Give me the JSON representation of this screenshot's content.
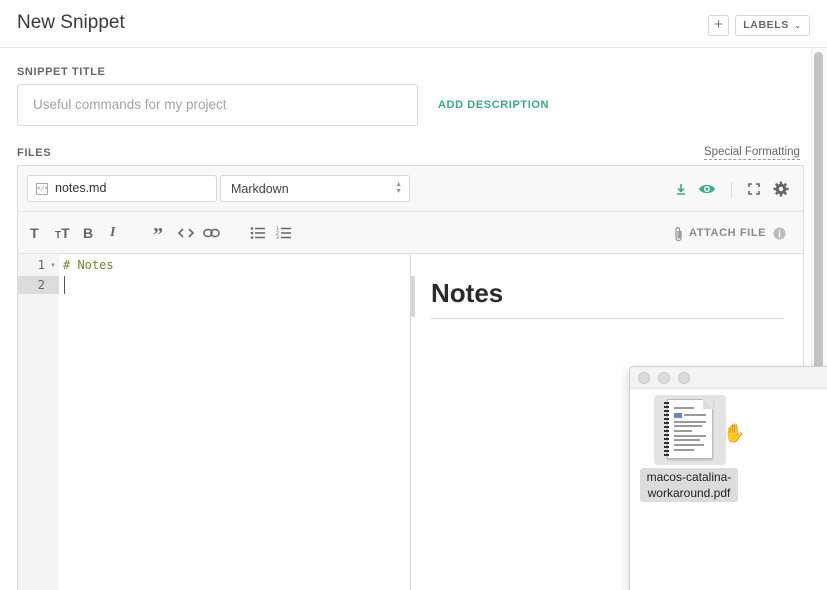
{
  "header": {
    "title": "New Snippet",
    "add_label": "+",
    "labels_button": "LABELS"
  },
  "snippet_title": {
    "label": "SNIPPET TITLE",
    "placeholder": "Useful commands for my project",
    "add_description": "ADD DESCRIPTION"
  },
  "files": {
    "label": "FILES",
    "special_formatting": "Special Formatting",
    "filename": "notes.md",
    "language": "Markdown",
    "icons": [
      "download-icon",
      "eye-icon",
      "fullscreen-icon",
      "gear-icon"
    ],
    "accent_color": "#3ba98b"
  },
  "format_toolbar": {
    "buttons": [
      {
        "name": "heading-icon",
        "glyph": "T"
      },
      {
        "name": "text-size-icon",
        "glyph": "TT"
      },
      {
        "name": "bold-icon",
        "glyph": "B"
      },
      {
        "name": "italic-icon",
        "glyph": "I"
      },
      {
        "name": "quote-icon",
        "glyph": "”"
      },
      {
        "name": "code-icon",
        "glyph": "<>"
      },
      {
        "name": "link-icon",
        "glyph": "link"
      },
      {
        "name": "bullet-list-icon",
        "glyph": "ul"
      },
      {
        "name": "numbered-list-icon",
        "glyph": "ol"
      }
    ],
    "attach_file": "ATTACH FILE"
  },
  "editor": {
    "lines": [
      {
        "number": "1",
        "text": "# Notes"
      },
      {
        "number": "2",
        "text": ""
      }
    ]
  },
  "preview": {
    "heading": "Notes"
  },
  "finder": {
    "file_name": "macos-catalina-workaround.pdf"
  }
}
